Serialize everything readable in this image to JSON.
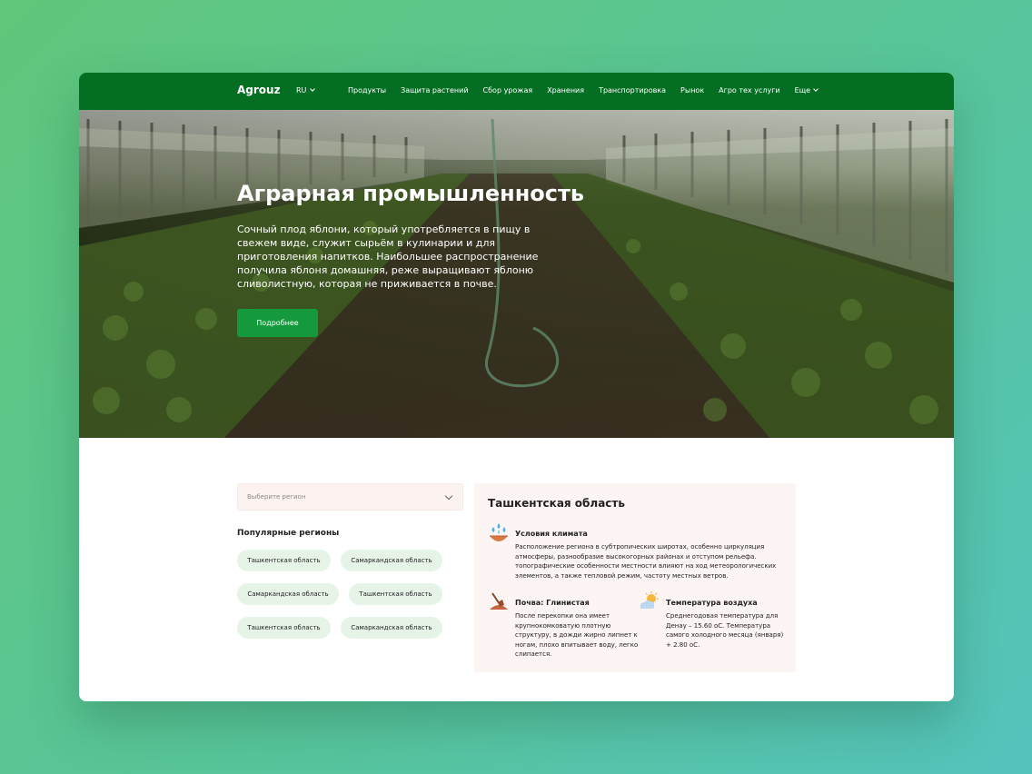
{
  "nav": {
    "logo": "Agrouz",
    "lang": "RU",
    "items": [
      "Продукты",
      "Защита растений",
      "Сбор урожая",
      "Хранения",
      "Транспортировка",
      "Рынок",
      "Агро тех услуги",
      "Еще"
    ]
  },
  "hero": {
    "title": "Аграрная промышленность",
    "text": "Сочный плод яблони, который употребляется в пищу в свежем виде, служит сырьём в кулинарии и для приготовления напитков. Наибольшее распространение получила яблоня домашняя, реже выращивают яблоню сливолистную, которая не приживается в  почве.",
    "button": "Подробнее"
  },
  "regions": {
    "placeholder": "Выберите регион",
    "popular_title": "Популярные регионы",
    "chips": [
      "Ташкентская область",
      "Самаркандская область",
      "Самаркандская область",
      "Ташкентская область",
      "Ташкентская область",
      "Самаркандская область"
    ]
  },
  "info": {
    "title": "Ташкентская область",
    "climate": {
      "title": "Условия климата",
      "text": "Расположение региона в субтропических широтах, особенно циркуляция атмосферы, разнообразие высокогорных районах и отступом рельефа. топографические особенности местности влияют на ход метеорологических элементов, а также тепловой режим, частоту местных ветров.",
      "icon": "water-drops-icon"
    },
    "soil": {
      "title": "Почва: Глинистая",
      "text": "После перекопки она имеет крупнокомковатую плотную структуру, в дожди жирно липнет к ногам, плохо впитывает воду, легко слипается.",
      "icon": "shovel-icon"
    },
    "temperature": {
      "title": "Температура воздуха",
      "text": "Среднегодовая температура для Денау – 15.60 оС. Температура самого холодного месяца (января) + 2.80 оС.",
      "icon": "sun-cloud-icon"
    }
  },
  "colors": {
    "nav_bg": "#046f22",
    "button": "#149a3c",
    "chip_bg": "#e6f4e8",
    "card_bg": "#fdf5f3"
  }
}
